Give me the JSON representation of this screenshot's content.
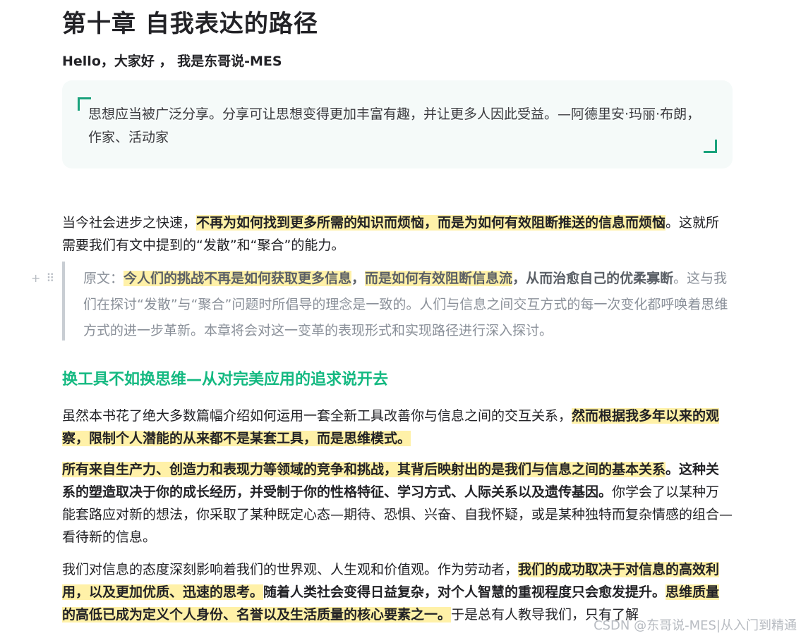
{
  "article": {
    "title": "第十章 自我表达的路径",
    "greeting": "Hello，大家好 ， 我是东哥说-MES",
    "epigraph": "思想应当被广泛分享。分享可让思想变得更加丰富有趣，并让更多人因此受益。—阿德里安·玛丽·布朗，作家、活动家",
    "p1": {
      "a": "当今社会进步之快速，",
      "hl": "不再为如何找到更多所需的知识而烦恼，而是为如何有效阻断推送的信息而烦恼",
      "b": "。这就所需要我们有文中提到的“发散”和“聚合”的能力。"
    },
    "blockquote": {
      "a": "原文：",
      "hl1": "今人们的挑战不再是如何获取更多信息",
      "b": "，",
      "hl2": "而是如何有效阻断信息流",
      "c": "，从而治愈自己的优柔寡断",
      "d": "。这与我们在探讨“发散”与“聚合”问题时所倡导的理念是一致的。人们与信息之间交互方式的每一次变化都呼唤着思维方式的进一步革新。本章将会对这一变革的表现形式和实现路径进行深入探讨。"
    },
    "section_heading": "换工具不如换思维—从对完美应用的追求说开去",
    "p2": {
      "a": "虽然本书花了绝大多数篇幅介绍如何运用一套全新工具改善你与信息之间的交互关系，",
      "hl": "然而根据我多年以来的观察，限制个人潜能的从来都不是某套工具，而是思维模式。"
    },
    "p3": {
      "hl": "所有来自生产力、创造力和表现力等领域的竞争和挑战，其背后映射出的是我们与信息之间的基本关系",
      "b": "。这种关系的塑造取决于你的成长经历，并受制于你的性格特征、学习方式、人际关系以及遗传基因。",
      "c": "你学会了以某种万能套路应对新的想法，你采取了某种既定心态—期待、恐惧、兴奋、自我怀疑，或是某种独特而复杂情感的组合—看待新的信息。"
    },
    "p4": {
      "a": "我们对信息的态度深刻影响着我们的世界观、人生观和价值观。作为劳动者，",
      "hl1": "我们的成功取决于对信息的高效利用，以及更加优质、迅速的思考。",
      "b": "随着人类社会变得日益复杂，对个人智慧的重视程度只会愈发提升。",
      "hl2": "思维质量的高低已成为定义个人身份、名誉以及生活质量的核心要素之一。",
      "c": "于是总有人教导我们，只有了解"
    }
  },
  "editor": {
    "add_icon": "+",
    "drag_icon": "⠿"
  },
  "watermark": "CSDN @东哥说-MES|从入门到精通",
  "colors": {
    "accent": "#14b981",
    "highlight": "#fff1a8",
    "quote_bar": "#c8cdd3"
  }
}
